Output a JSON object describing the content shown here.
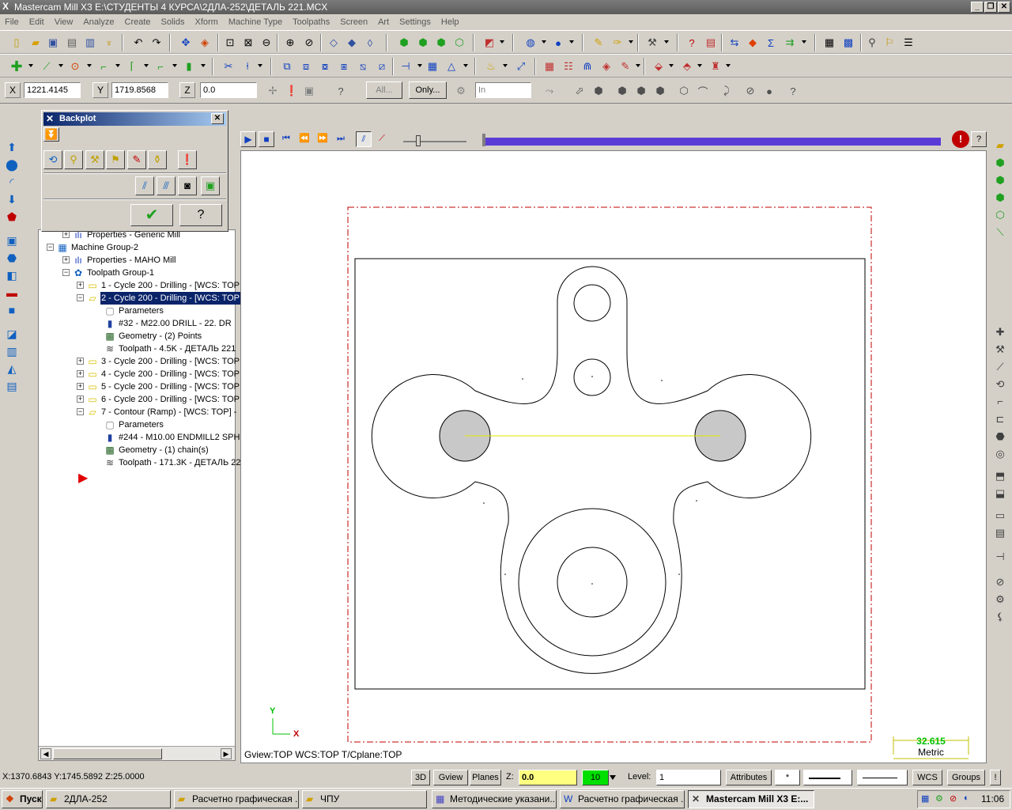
{
  "window": {
    "title": "Mastercam Mill X3  E:\\СТУДЕНТЫ 4 КУРСА\\2ДЛА-252\\ДЕТАЛЬ 221.MCX",
    "logo": "X",
    "minimize": "_",
    "restore": "❐",
    "close": "✕"
  },
  "menu": [
    "File",
    "Edit",
    "View",
    "Analyze",
    "Create",
    "Solids",
    "Xform",
    "Machine Type",
    "Toolpaths",
    "Screen",
    "Art",
    "Settings",
    "Help"
  ],
  "coords": {
    "x_label": "X",
    "x_value": "1221.4145",
    "y_label": "Y",
    "y_value": "1719.8568",
    "z_label": "Z",
    "z_value": "0.0",
    "all_button": "All...",
    "only_button": "Only...",
    "in_select": "In"
  },
  "backplot": {
    "title": "Backplot",
    "ok": "✔",
    "help": "?"
  },
  "tree": {
    "rows": [
      {
        "label": "Properties - Generic Mill",
        "level": 1,
        "icon": "properties-icon",
        "glyph": "ılı",
        "expander": "+"
      },
      {
        "label": "Machine Group-2",
        "level": 0,
        "icon": "machine-group-icon",
        "glyph": "▦",
        "expander": "−"
      },
      {
        "label": "Properties - MAHO Mill",
        "level": 1,
        "icon": "properties-icon",
        "glyph": "ılı",
        "expander": "+"
      },
      {
        "label": "Toolpath Group-1",
        "level": 1,
        "icon": "toolpath-group-icon",
        "glyph": "✿",
        "expander": "−"
      },
      {
        "label": "1 - Cycle 200 - Drilling - [WCS: TOP",
        "level": 2,
        "icon": "folder-icon",
        "glyph": "▭",
        "expander": "+"
      },
      {
        "label": "2 - Cycle 200 - Drilling - [WCS: TOP",
        "level": 2,
        "icon": "folder-open-icon",
        "glyph": "▱",
        "expander": "−",
        "selected": true
      },
      {
        "label": "Parameters",
        "level": 3,
        "icon": "parameters-icon",
        "glyph": "▢"
      },
      {
        "label": "#32 - M22.00 DRILL -      22. DR",
        "level": 3,
        "icon": "tool-icon",
        "glyph": "▮"
      },
      {
        "label": "Geometry - (2) Points",
        "level": 3,
        "icon": "geometry-icon",
        "glyph": "▩"
      },
      {
        "label": "Toolpath - 4.5K - ДЕТАЛЬ 221",
        "level": 3,
        "icon": "toolpath-icon",
        "glyph": "≋"
      },
      {
        "label": "3 - Cycle 200 - Drilling - [WCS: TOP",
        "level": 2,
        "icon": "folder-icon",
        "glyph": "▭",
        "expander": "+"
      },
      {
        "label": "4 - Cycle 200 - Drilling - [WCS: TOP",
        "level": 2,
        "icon": "folder-icon",
        "glyph": "▭",
        "expander": "+"
      },
      {
        "label": "5 - Cycle 200 - Drilling - [WCS: TOP",
        "level": 2,
        "icon": "folder-icon",
        "glyph": "▭",
        "expander": "+"
      },
      {
        "label": "6 - Cycle 200 - Drilling - [WCS: TOP",
        "level": 2,
        "icon": "folder-icon",
        "glyph": "▭",
        "expander": "+"
      },
      {
        "label": "7 - Contour (Ramp) - [WCS: TOP] -",
        "level": 2,
        "icon": "folder-open-icon",
        "glyph": "▱",
        "expander": "−"
      },
      {
        "label": "Parameters",
        "level": 3,
        "icon": "parameters-icon",
        "glyph": "▢"
      },
      {
        "label": "#244 - M10.00 ENDMILL2 SPHE",
        "level": 3,
        "icon": "tool-icon",
        "glyph": "▮"
      },
      {
        "label": "Geometry - (1) chain(s)",
        "level": 3,
        "icon": "geometry-icon",
        "glyph": "▩"
      },
      {
        "label": "Toolpath - 171.3K - ДЕТАЛЬ 22",
        "level": 3,
        "icon": "toolpath-icon",
        "glyph": "≋"
      }
    ]
  },
  "viewport": {
    "view_info": "Gview:TOP   WCS:TOP   T/Cplane:TOP",
    "axis_y": "Y",
    "axis_x": "X",
    "scale_value": "32.615",
    "scale_unit": "Metric"
  },
  "status": {
    "coords": "X:1370.6843  Y:1745.5892  Z:25.0000",
    "btn_3d": "3D",
    "btn_gview": "Gview",
    "btn_planes": "Planes",
    "z_label": "Z:",
    "z_value": "0.0",
    "color_value": "10",
    "level_label": "Level:",
    "level_value": "1",
    "attributes": "Attributes",
    "point_style": "*",
    "wcs": "WCS",
    "groups": "Groups",
    "bang": "!"
  },
  "taskbar": {
    "start": "Пуск",
    "items": [
      {
        "label": "2ДЛА-252",
        "icon": "folder-icon"
      },
      {
        "label": "Расчетно графическая ...",
        "icon": "folder-icon"
      },
      {
        "label": "ЧПУ",
        "icon": "folder-icon"
      },
      {
        "label": "Методические указани...",
        "icon": "app-icon"
      },
      {
        "label": "Расчетно графическая ...",
        "icon": "word-icon"
      },
      {
        "label": "Mastercam Mill X3  E:...",
        "icon": "mastercam-icon"
      }
    ],
    "clock": "11:06"
  },
  "colors": {
    "title_bg": "#6b6b6b",
    "selection": "#0a246a",
    "progress": "#5b3bd6",
    "stock_border": "#c00000",
    "toolpath_line": "#e6e600",
    "scale_color": "#00c000"
  }
}
